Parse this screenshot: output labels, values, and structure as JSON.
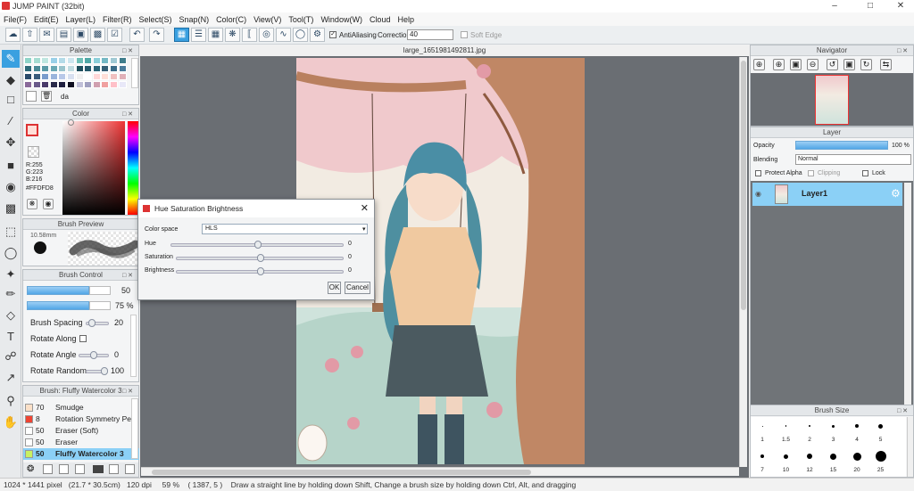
{
  "window": {
    "title": "JUMP PAINT (32bit)"
  },
  "menu": [
    "File(F)",
    "Edit(E)",
    "Layer(L)",
    "Filter(R)",
    "Select(S)",
    "Snap(N)",
    "Color(C)",
    "View(V)",
    "Tool(T)",
    "Window(W)",
    "Cloud",
    "Help"
  ],
  "toolbar": {
    "antialiasing_label": "AntiAliasing",
    "correction_label": "Correction",
    "correction_value": "40",
    "softedge_label": "Soft Edge"
  },
  "palette": {
    "title": "Palette",
    "name": "da"
  },
  "color": {
    "title": "Color",
    "r": "R:255",
    "g": "G:223",
    "b": "B:216",
    "hex": "#FFDFD8"
  },
  "brush_preview": {
    "title": "Brush Preview",
    "size": "10.58mm"
  },
  "brush_control": {
    "title": "Brush Control",
    "size_value": "50",
    "opacity_value": "75 %",
    "spacing_label": "Brush Spacing",
    "spacing_value": "20",
    "rotate_along_label": "Rotate Along",
    "rotate_angle_label": "Rotate Angle",
    "rotate_angle_value": "0",
    "rotate_random_label": "Rotate Random",
    "rotate_random_value": "100"
  },
  "brush_list": {
    "title": "Brush: Fluffy Watercolor 3",
    "items": [
      {
        "size": "70",
        "name": "Smudge"
      },
      {
        "size": "8",
        "name": "Rotation Symmetry Pe"
      },
      {
        "size": "50",
        "name": "Eraser (Soft)"
      },
      {
        "size": "50",
        "name": "Eraser"
      },
      {
        "size": "50",
        "name": "Fluffy Watercolor 3"
      }
    ]
  },
  "document": {
    "tab": "large_1651981492811.jpg"
  },
  "dialog": {
    "title": "Hue Saturation Brightness",
    "color_space_label": "Color space",
    "color_space_value": "HLS",
    "hue_label": "Hue",
    "hue_value": "0",
    "saturation_label": "Saturation",
    "saturation_value": "0",
    "brightness_label": "Brightness",
    "brightness_value": "0",
    "ok": "OK",
    "cancel": "Cancel"
  },
  "navigator": {
    "title": "Navigator"
  },
  "layer": {
    "title": "Layer",
    "opacity_label": "Opacity",
    "opacity_value": "100 %",
    "blending_label": "Blending",
    "blending_value": "Normal",
    "protect_alpha": "Protect Alpha",
    "clipping": "Clipping",
    "lock": "Lock",
    "layer_name": "Layer1"
  },
  "brush_size": {
    "title": "Brush Size",
    "row1": [
      "1",
      "1.5",
      "2",
      "3",
      "4",
      "5"
    ],
    "row2": [
      "7",
      "10",
      "12",
      "15",
      "20",
      "25"
    ]
  },
  "status": {
    "text": "1024 * 1441 pixel   (21.7 * 30.5cm)   120 dpi     59 %    ( 1387, 5 )    Draw a straight line by holding down Shift, Change a brush size by holding down Ctrl, Alt, and dragging"
  },
  "colors": {
    "accent": "#3aa0e0",
    "selected_row": "#8bd0f6",
    "foreground": "#FFDFD8"
  }
}
